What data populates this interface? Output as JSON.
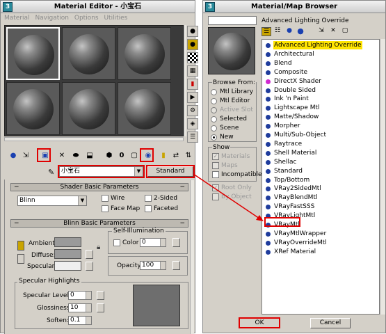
{
  "material_editor": {
    "title": "Material Editor - 小宝石",
    "menu": [
      "Material",
      "Navigation",
      "Options",
      "Utilities"
    ],
    "material_name": "小宝石",
    "type_button": "Standard",
    "shader_rollout": {
      "title": "Shader Basic Parameters",
      "shader": "Blinn",
      "wire": "Wire",
      "two_sided": "2-Sided",
      "face_map": "Face Map",
      "faceted": "Faceted"
    },
    "blinn_rollout": {
      "title": "Blinn Basic Parameters",
      "self_illum_title": "Self-Illumination",
      "color_label": "Color",
      "color_value": "0",
      "ambient": "Ambient:",
      "diffuse": "Diffuse:",
      "specular": "Specular:",
      "opacity_label": "Opacity:",
      "opacity_value": "100",
      "lock_icon": "lock-icon"
    },
    "specular_highlights": {
      "title": "Specular Highlights",
      "level_label": "Specular Level:",
      "level_value": "0",
      "gloss_label": "Glossiness:",
      "gloss_value": "10",
      "soften_label": "Soften:",
      "soften_value": "0.1"
    }
  },
  "browser": {
    "title": "Material/Map Browser",
    "selected_label": "Advanced Lighting Override",
    "browse_from": {
      "title": "Browse From:",
      "options": [
        "Mtl Library",
        "Mtl Editor",
        "Active Slot",
        "Selected",
        "Scene",
        "New"
      ],
      "selected": "New"
    },
    "show": {
      "title": "Show",
      "options": [
        "Materials",
        "Maps",
        "Incompatible"
      ]
    },
    "extra_checks": [
      "Root Only",
      "By Object"
    ],
    "items": [
      "Advanced Lighting Override",
      "Architectural",
      "Blend",
      "Composite",
      "DirectX Shader",
      "Double Sided",
      "Ink 'n Paint",
      "Lightscape Mtl",
      "Matte/Shadow",
      "Morpher",
      "Multi/Sub-Object",
      "Raytrace",
      "Shell Material",
      "Shellac",
      "Standard",
      "Top/Bottom",
      "VRay2SidedMtl",
      "VRayBlendMtl",
      "VRayFastSSS",
      "VRayLightMtl",
      "VRayMtl",
      "VRayMtlWrapper",
      "VRayOverrideMtl",
      "XRef Material"
    ],
    "ok": "OK",
    "cancel": "Cancel"
  },
  "colors": {
    "highlight": "#ffe400",
    "annotation": "#e00000",
    "bullet": "#1f3c9c"
  }
}
